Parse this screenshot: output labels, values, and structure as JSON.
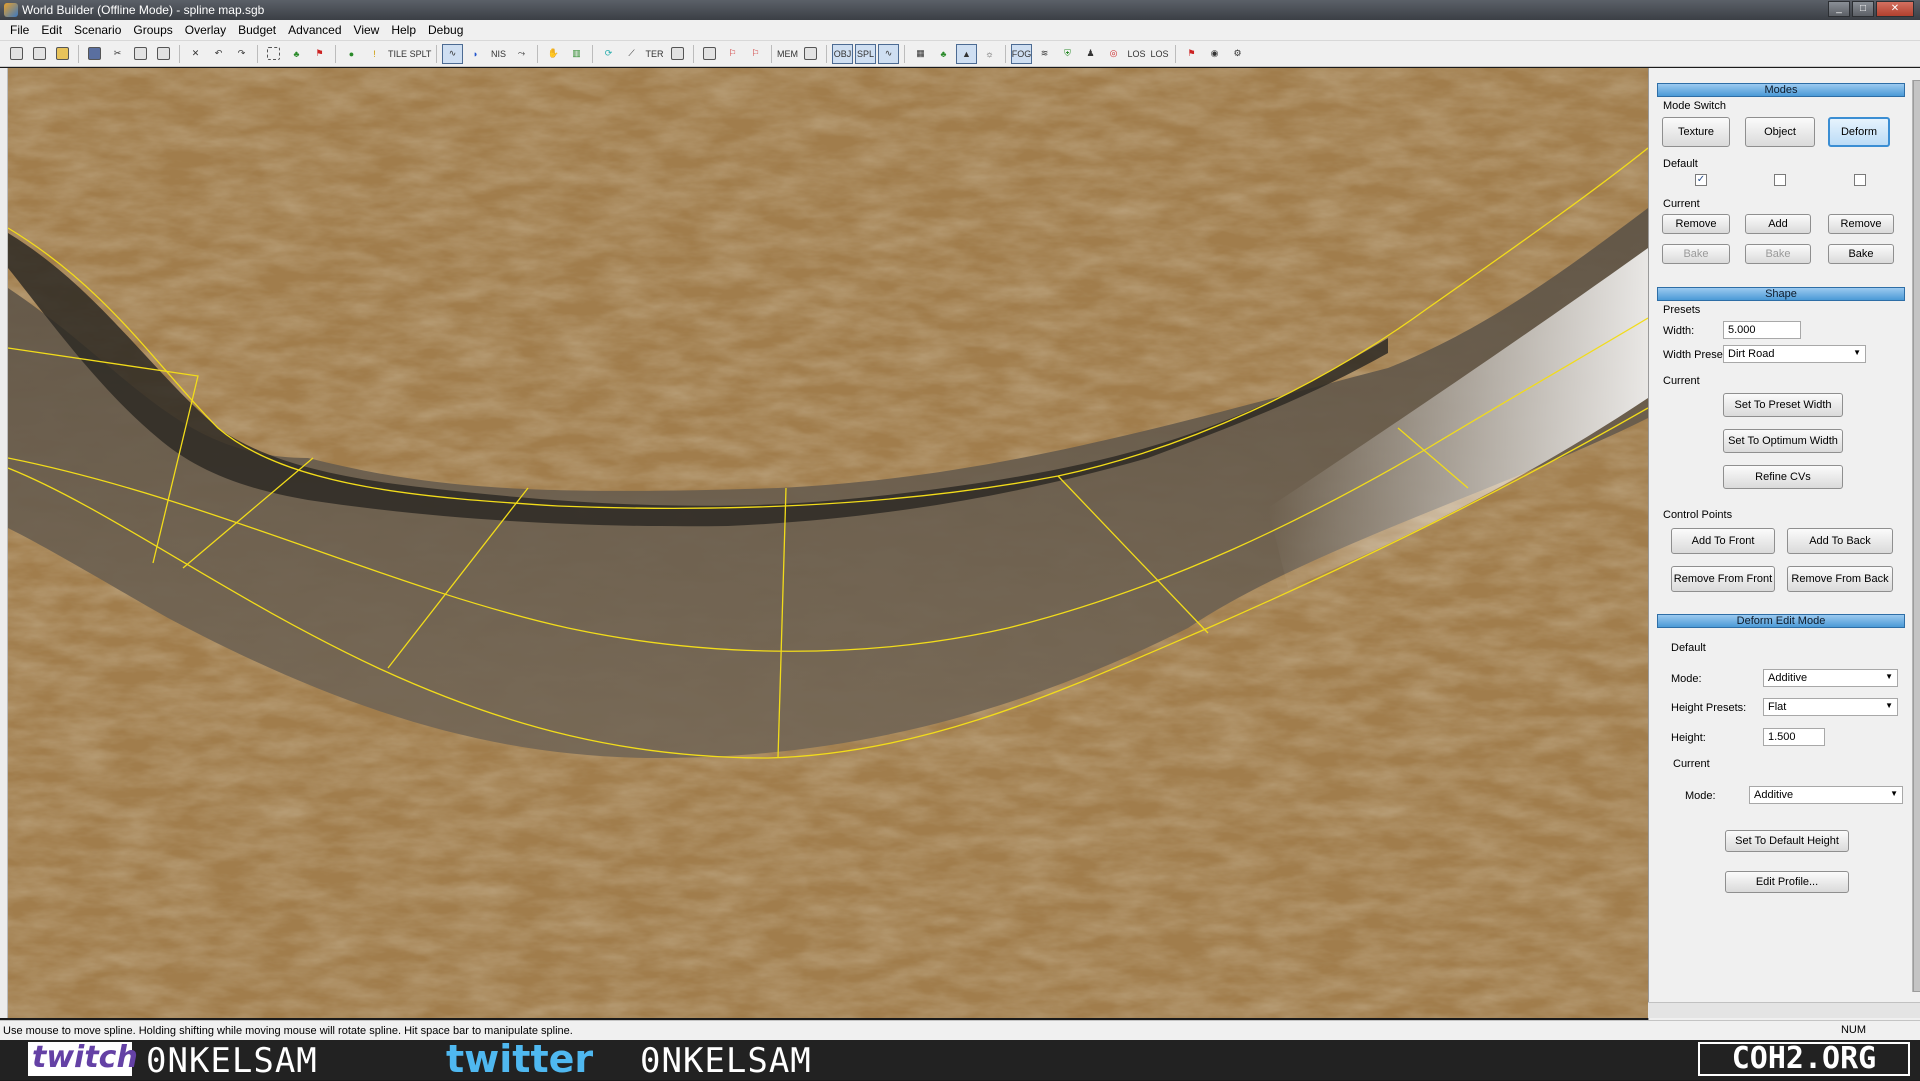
{
  "window": {
    "title": "World Builder (Offline Mode) - spline map.sgb"
  },
  "menu": [
    "File",
    "Edit",
    "Scenario",
    "Groups",
    "Overlay",
    "Budget",
    "Advanced",
    "View",
    "Help",
    "Debug"
  ],
  "toolbar": {
    "labels": {
      "tile": "TILE",
      "split": "SPLT",
      "nis": "NIS",
      "ter": "TER",
      "mem": "MEM",
      "obj": "OBJ",
      "spl": "SPL",
      "fog": "FOG",
      "los1": "LOS",
      "los2": "LOS"
    }
  },
  "modes": {
    "header": "Modes",
    "mode_switch_label": "Mode Switch",
    "buttons": [
      "Texture",
      "Object",
      "Deform"
    ],
    "selected": "Deform",
    "default_label": "Default",
    "default_checks": [
      true,
      false,
      false
    ],
    "check_mark": "✓",
    "current_label": "Current",
    "current_buttons": [
      "Remove",
      "Add",
      "Remove"
    ],
    "bake_buttons": [
      "Bake",
      "Bake",
      "Bake"
    ]
  },
  "shape": {
    "header": "Shape",
    "presets_label": "Presets",
    "width_label": "Width:",
    "width_value": "5.000",
    "width_presets_label": "Width Presets:",
    "width_presets_value": "Dirt Road",
    "current_label": "Current",
    "set_preset_width": "Set To Preset Width",
    "set_optimum_width": "Set To Optimum Width",
    "refine_cvs": "Refine CVs",
    "control_points_label": "Control Points",
    "add_front": "Add To Front",
    "add_back": "Add To Back",
    "remove_front": "Remove From Front",
    "remove_back": "Remove From Back"
  },
  "deform": {
    "header": "Deform Edit Mode",
    "default_label": "Default",
    "mode_label": "Mode:",
    "mode_value": "Additive",
    "height_presets_label": "Height Presets:",
    "height_presets_value": "Flat",
    "height_label": "Height:",
    "height_value": "1.500",
    "current_label": "Current",
    "current_mode_label": "Mode:",
    "current_mode_value": "Additive",
    "set_default_height": "Set To Default Height",
    "edit_profile": "Edit Profile..."
  },
  "status": {
    "message": "Use mouse to move spline. Holding shifting while moving mouse will rotate spline. Hit space bar to manipulate spline.",
    "indicator": "NUM"
  },
  "overlay": {
    "twitch_logo": "twitch",
    "twitch_name": "0NKELSAM",
    "twitter_logo": "twitter",
    "twitter_name": "0NKELSAM",
    "site_logo": "COH2.ORG"
  },
  "colors": {
    "terrain": "#a4804f",
    "spline": "#f2dc1a",
    "accent": "#4b9ad6"
  }
}
